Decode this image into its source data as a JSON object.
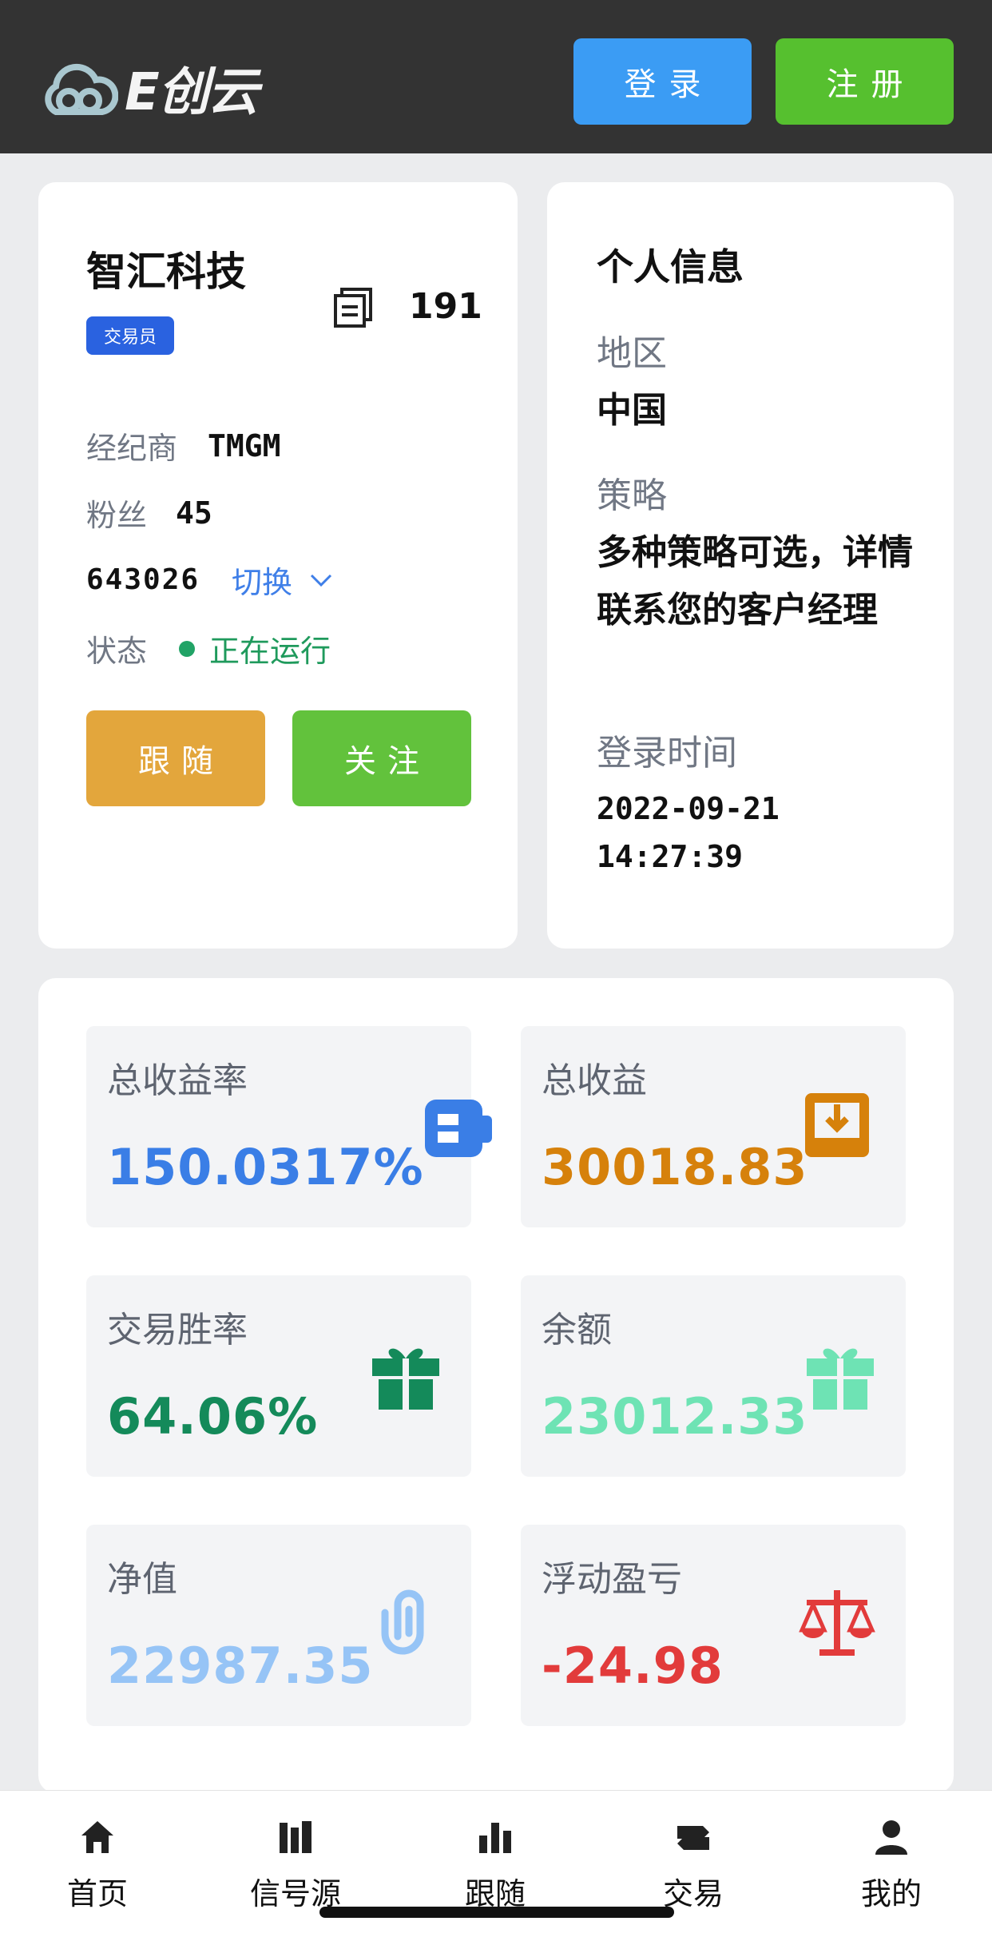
{
  "header": {
    "logo_text": "E创云",
    "login_label": "登录",
    "register_label": "注册",
    "colors": {
      "background": "#333333",
      "login": "#3b9cf4",
      "register": "#56c02f"
    }
  },
  "trader": {
    "name": "智汇科技",
    "role_badge": "交易员",
    "copy_count": "191",
    "broker_label": "经纪商",
    "broker_value": "TMGM",
    "fans_label": "粉丝",
    "fans_value": "45",
    "account_id": "643026",
    "switch_label": "切换",
    "status_label": "状态",
    "status_value": "正在运行",
    "follow_button": "跟随",
    "watch_button": "关注"
  },
  "profile": {
    "title": "个人信息",
    "region_label": "地区",
    "region_value": "中国",
    "strategy_label": "策略",
    "strategy_value": "多种策略可选，详情联系您的客户经理",
    "login_time_label": "登录时间",
    "login_date": "2022-09-21",
    "login_time": "14:27:39"
  },
  "stats": [
    {
      "label": "总收益率",
      "value": "150.0317%",
      "color": "#3a7ee6",
      "icon": "ticket-icon"
    },
    {
      "label": "总收益",
      "value": "30018.83",
      "color": "#d6810b",
      "icon": "download-tray-icon"
    },
    {
      "label": "交易胜率",
      "value": "64.06%",
      "color": "#148a5a",
      "icon": "gift-icon"
    },
    {
      "label": "余额",
      "value": "23012.33",
      "color": "#6ee3b4",
      "icon": "gift-icon"
    },
    {
      "label": "净值",
      "value": "22987.35",
      "color": "#96c4f6",
      "icon": "paperclip-icon"
    },
    {
      "label": "浮动盈亏",
      "value": "-24.98",
      "color": "#e23b3b",
      "icon": "scale-icon"
    }
  ],
  "nav": [
    {
      "label": "首页",
      "icon": "home-icon"
    },
    {
      "label": "信号源",
      "icon": "signal-icon"
    },
    {
      "label": "跟随",
      "icon": "bar-chart-icon"
    },
    {
      "label": "交易",
      "icon": "trade-icon"
    },
    {
      "label": "我的",
      "icon": "user-icon"
    }
  ]
}
